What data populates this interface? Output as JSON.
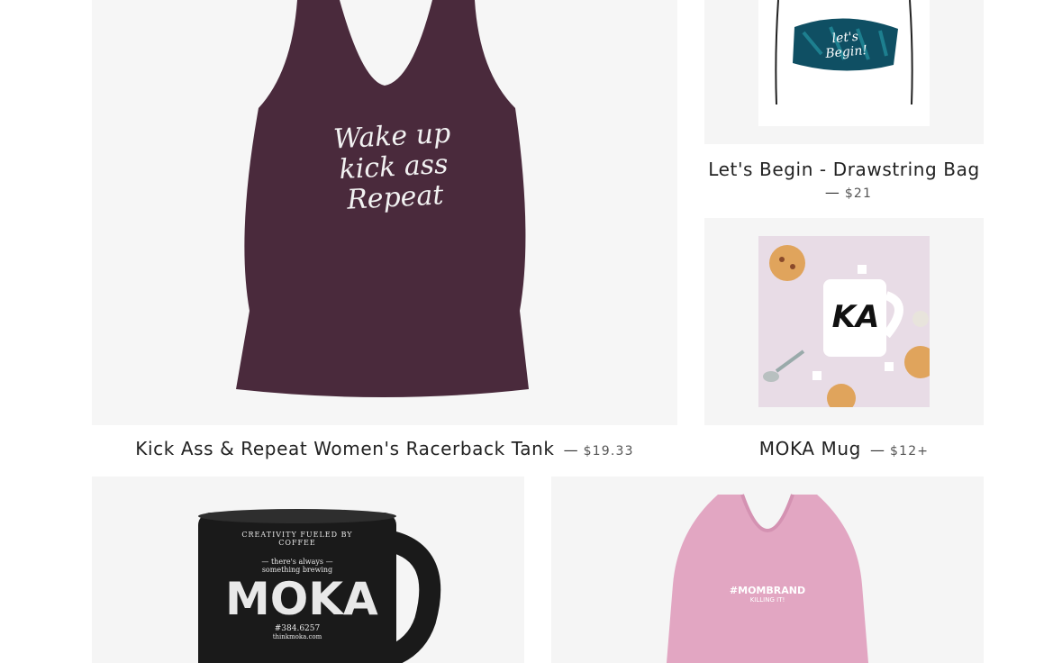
{
  "products": [
    {
      "id": "tank",
      "title": "Kick Ass & Repeat Women's Racerback Tank",
      "dash": "—",
      "price": "$19.33",
      "image_text": [
        "Wake up",
        "kick ass",
        "Repeat"
      ],
      "color": "#4a2a3c"
    },
    {
      "id": "bag",
      "title": "Let's Begin - Drawstring Bag",
      "dash": "—",
      "price": "$21",
      "image_text": [
        "let's",
        "Begin!"
      ],
      "color": "#ffffff"
    },
    {
      "id": "mug",
      "title": "MOKA Mug",
      "dash": "—",
      "price": "$12+",
      "image_text": [
        "KA"
      ],
      "color": "#e8dce6"
    },
    {
      "id": "black-mug",
      "image_text": [
        "CREATIVITY FUELED BY COFFEE",
        "— there's always —",
        "something brewing",
        "MOKA",
        "#384.6257",
        "thinkmoka.com"
      ],
      "color": "#1a1a1a"
    },
    {
      "id": "pink-tee",
      "image_text": [
        "#MOMBRAND",
        "KILLING IT!"
      ],
      "color": "#e2a6c2"
    }
  ]
}
